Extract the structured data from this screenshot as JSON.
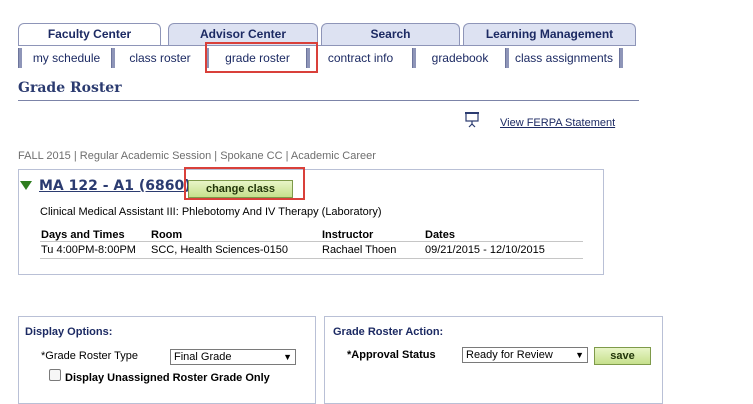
{
  "top_tabs": [
    "Faculty Center",
    "Advisor Center",
    "Search",
    "Learning Management"
  ],
  "sub_tabs": [
    "my schedule",
    "class roster",
    "grade roster",
    "contract info",
    "gradebook",
    "class assignments"
  ],
  "page_title": "Grade Roster",
  "ferpa_link": "View FERPA Statement",
  "term_line": "FALL 2015 | Regular Academic Session | Spokane CC | Academic Career",
  "class": {
    "title": "MA 122 - A1 (6860)",
    "change_button": "change class",
    "description": "Clinical Medical Assistant III:  Phlebotomy And IV Therapy (Laboratory)",
    "headers": [
      "Days and Times",
      "Room",
      "Instructor",
      "Dates"
    ],
    "row": [
      "Tu 4:00PM-8:00PM",
      "SCC, Health Sciences-0150",
      "Rachael Thoen",
      "09/21/2015 - 12/10/2015"
    ]
  },
  "display_options": {
    "title": "Display Options:",
    "roster_type_label": "*Grade Roster Type",
    "roster_type_value": "Final Grade",
    "unassigned_label": "Display Unassigned Roster Grade Only"
  },
  "roster_action": {
    "title": "Grade Roster Action:",
    "approval_label": "*Approval Status",
    "approval_value": "Ready for Review",
    "save_button": "save"
  },
  "colors": {
    "highlight": "#d9403a",
    "green_button": "#c6e08c",
    "link": "#1c2a63"
  }
}
